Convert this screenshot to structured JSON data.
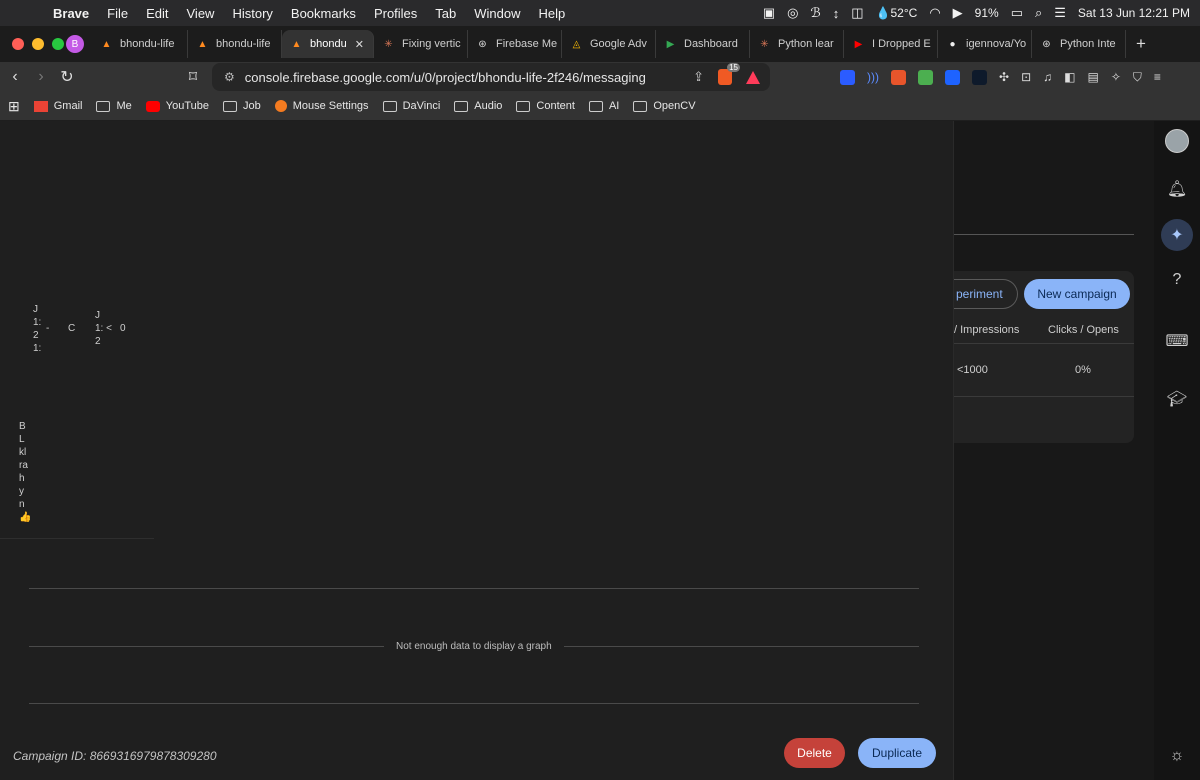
{
  "menubar": {
    "apple_icon": "apple-logo",
    "app_name": "Brave",
    "items": [
      "File",
      "Edit",
      "View",
      "History",
      "Bookmarks",
      "Profiles",
      "Tab",
      "Window",
      "Help"
    ],
    "temperature": "52°C",
    "battery": "91%",
    "datetime": "Sat 13 Jun  12:21 PM"
  },
  "tabs": [
    {
      "label": "bhondu-life",
      "icon": "firebase-icon",
      "active": false
    },
    {
      "label": "bhondu-life",
      "icon": "firebase-icon",
      "active": false
    },
    {
      "label": "bhondu",
      "icon": "firebase-icon",
      "active": true
    },
    {
      "label": "Fixing vertic",
      "icon": "claude-icon",
      "active": false
    },
    {
      "label": "Firebase Me",
      "icon": "chatgpt-icon",
      "active": false
    },
    {
      "label": "Google Adv",
      "icon": "google-ads-icon",
      "active": false
    },
    {
      "label": "Dashboard",
      "icon": "play-console-icon",
      "active": false
    },
    {
      "label": "Python lear",
      "icon": "claude-icon",
      "active": false
    },
    {
      "label": "I Dropped E",
      "icon": "youtube-icon",
      "active": false
    },
    {
      "label": "igennova/Yo",
      "icon": "github-icon",
      "active": false
    },
    {
      "label": "Python Inte",
      "icon": "chatgpt-icon",
      "active": false
    }
  ],
  "toolbar": {
    "url": "console.firebase.google.com/u/0/project/bhondu-life-2f246/messaging",
    "shields_count": "15"
  },
  "bookmarks": [
    {
      "label": "Gmail",
      "icon": "gmail-icon"
    },
    {
      "label": "Me",
      "icon": "folder-icon"
    },
    {
      "label": "YouTube",
      "icon": "youtube-icon"
    },
    {
      "label": "Job",
      "icon": "folder-icon"
    },
    {
      "label": "Mouse Settings",
      "icon": "mouse-settings-icon"
    },
    {
      "label": "DaVinci",
      "icon": "folder-icon"
    },
    {
      "label": "Audio",
      "icon": "folder-icon"
    },
    {
      "label": "Content",
      "icon": "folder-icon"
    },
    {
      "label": "AI",
      "icon": "folder-icon"
    },
    {
      "label": "OpenCV",
      "icon": "folder-icon"
    }
  ],
  "background": {
    "experiment_label": "periment",
    "new_campaign_label": "New campaign",
    "col_impressions": "/ Impressions",
    "col_clicks": "Clicks / Opens",
    "val_impressions": "<1000",
    "val_clicks": "0%"
  },
  "dialog": {
    "row_fragments": {
      "a": "J",
      "b": "1:",
      "c": "2",
      "d": "1:",
      "dash": "-",
      "c2": "C",
      "e": "J",
      "f": "1: <",
      "g": "2",
      "h": "0"
    },
    "body_fragments": [
      "B",
      "L",
      "kl",
      "ra",
      "h",
      "y",
      "n",
      "👍"
    ],
    "graph_message": "Not enough data to display a graph",
    "campaign_id": "Campaign ID: 8669316979878309280",
    "delete_label": "Delete",
    "duplicate_label": "Duplicate"
  },
  "colors": {
    "primary_button": "#8ab4f8",
    "danger_button": "#c5423a",
    "dialog_bg": "#1f1f1f"
  }
}
